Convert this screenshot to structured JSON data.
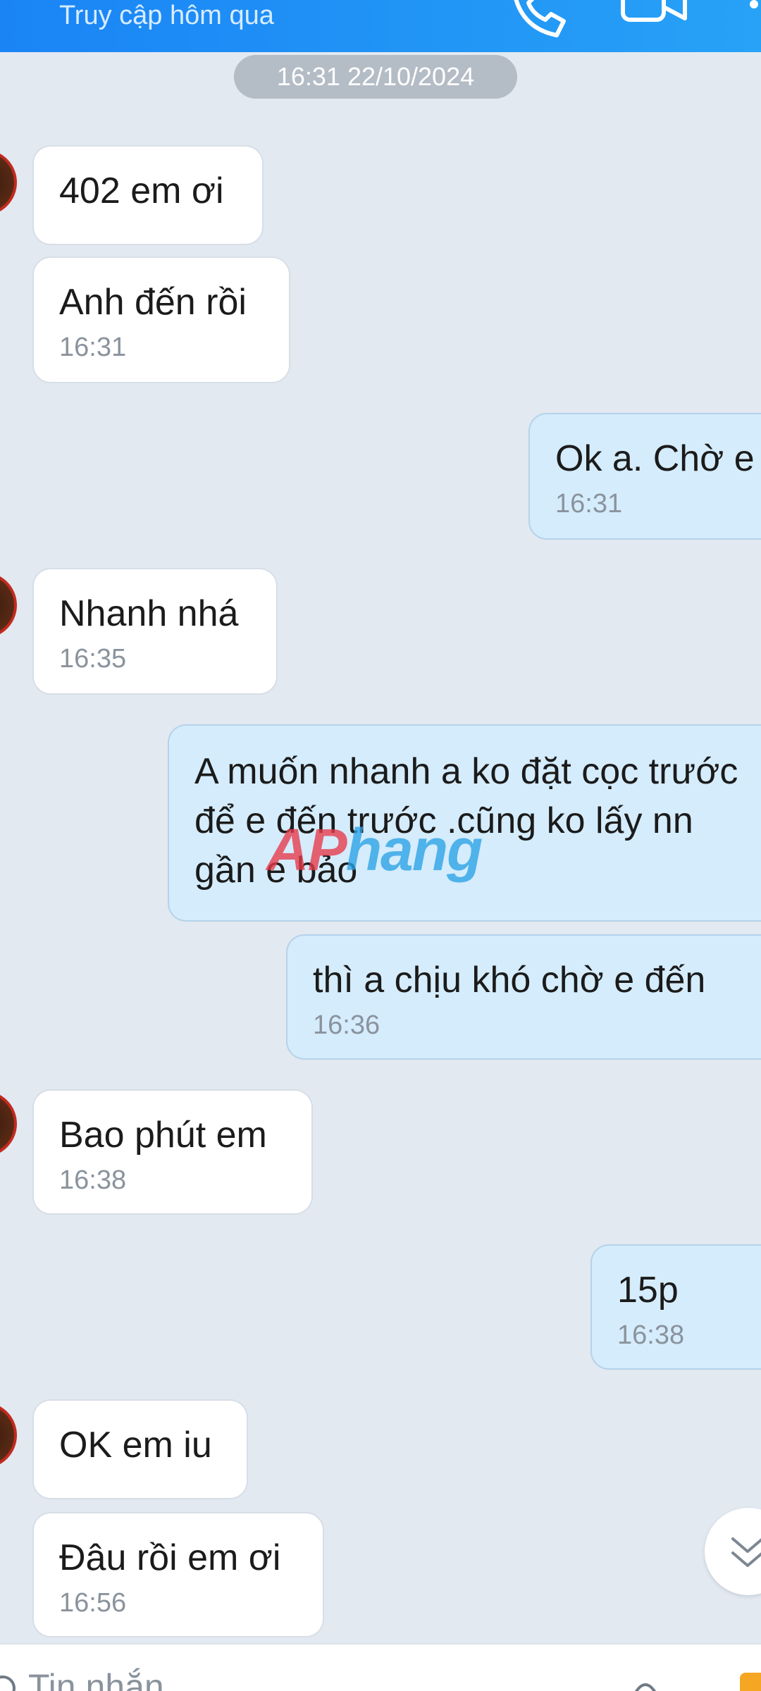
{
  "header": {
    "status": "Truy cập hôm qua",
    "icons": [
      "phone-icon",
      "video-call-icon",
      "more-icon"
    ]
  },
  "date_separator": "16:31 22/10/2024",
  "messages": [
    {
      "dir": "in",
      "text": "402 em ơi",
      "time": ""
    },
    {
      "dir": "in",
      "text": "Anh đến rồi",
      "time": "16:31"
    },
    {
      "dir": "out",
      "text": "Ok a. Chờ  e",
      "time": "16:31"
    },
    {
      "dir": "in",
      "text": "Nhanh nhá",
      "time": "16:35"
    },
    {
      "dir": "out",
      "text": "A muốn  nhanh a ko đặt cọc trước để  e đến trước  .cũng  ko lấy  nn gần  e bảo",
      "time": ""
    },
    {
      "dir": "out",
      "text": "thì  a chịu khó  chờ  e đến",
      "time": "16:36"
    },
    {
      "dir": "in",
      "text": "Bao phút em",
      "time": "16:38"
    },
    {
      "dir": "out",
      "text": "15p",
      "time": "16:38"
    },
    {
      "dir": "in",
      "text": "OK em iu",
      "time": ""
    },
    {
      "dir": "in",
      "text": "Đâu rồi em ơi",
      "time": "16:56"
    }
  ],
  "watermark": {
    "part1": "AP",
    "part2": "hang"
  },
  "composer": {
    "placeholder": "Tin nhắn"
  },
  "colors": {
    "header": "#1a84f5",
    "background": "#e2e9f1",
    "incoming_bubble": "#ffffff",
    "outgoing_bubble": "#d5ecfc",
    "timestamp": "#8a939d",
    "date_pill": "#b4bcc6"
  }
}
